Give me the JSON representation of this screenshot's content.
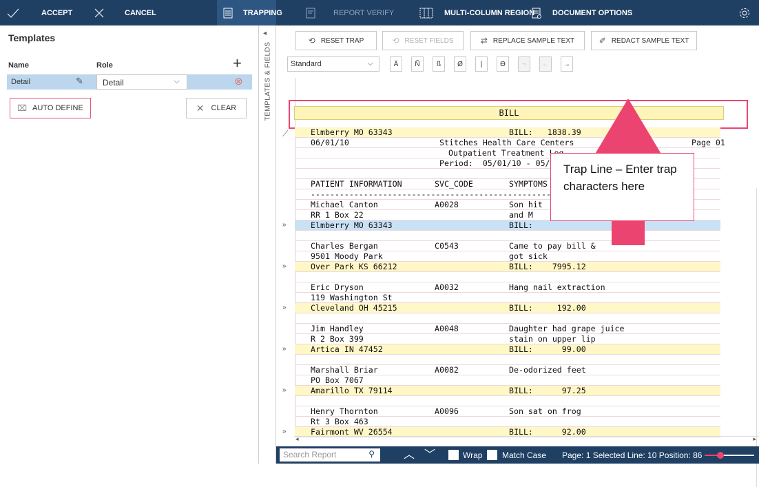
{
  "toolbar": {
    "accept_label": "ACCEPT",
    "cancel_label": "CANCEL",
    "trapping_label": "TRAPPING",
    "report_verify_label": "REPORT VERIFY",
    "multi_column_label": "MULTI-COLUMN REGION",
    "document_options_label": "DOCUMENT OPTIONS"
  },
  "templates": {
    "title": "Templates",
    "col_name": "Name",
    "col_role": "Role",
    "row": {
      "name": "Detail",
      "role": "Detail"
    },
    "auto_define_label": "AUTO DEFINE",
    "clear_label": "CLEAR",
    "side_tab_label": "TEMPLATES & FIELDS"
  },
  "actions": {
    "reset_trap": "RESET TRAP",
    "reset_fields": "RESET FIELDS",
    "replace_sample": "REPLACE SAMPLE TEXT",
    "redact_sample": "REDACT SAMPLE TEXT",
    "trap_type": "Standard",
    "char_buttons": [
      "Ä",
      "Ñ",
      "ß",
      "Ø",
      "|",
      "ϴ",
      "¬",
      "←",
      "→"
    ]
  },
  "trap_line": {
    "value": "BILL"
  },
  "report": {
    "lines": [
      {
        "c1": "Elmberry MO 63343",
        "c2": "",
        "c3": "BILL:   1838.39",
        "type": "hl"
      },
      {
        "c1": "06/01/10",
        "c2": "Stitches Health Care Centers",
        "c3": "Page 01",
        "type": "head1"
      },
      {
        "c1": "",
        "c2": "Outpatient Treatment Log",
        "c3": "",
        "type": "head2"
      },
      {
        "c1": "",
        "c2": "Period:  05/01/10 - 05/31/10",
        "c3": "",
        "type": "head3"
      },
      {
        "c1": "",
        "c2": "",
        "c3": "",
        "type": "blank"
      },
      {
        "c1": "PATIENT INFORMATION",
        "c2": "SVC_CODE",
        "c3": "SYMPTOMS",
        "type": "cols"
      },
      {
        "c1": "----------------------------------------------------------------",
        "c2": "",
        "c3": "",
        "type": "dash"
      },
      {
        "c1": "Michael Canton",
        "c2": "A0028",
        "c3": "Son hit",
        "type": "p"
      },
      {
        "c1": "RR 1 Box 22",
        "c2": "",
        "c3": "and M",
        "type": "p"
      },
      {
        "c1": "Elmberry MO 63343",
        "c2": "",
        "c3": "BILL:",
        "type": "sel"
      },
      {
        "c1": "",
        "c2": "",
        "c3": "",
        "type": "blank"
      },
      {
        "c1": "Charles Bergan",
        "c2": "C0543",
        "c3": "Came to pay bill &",
        "type": "p"
      },
      {
        "c1": "9501 Moody Park",
        "c2": "",
        "c3": "got sick",
        "type": "p"
      },
      {
        "c1": "Over Park KS 66212",
        "c2": "",
        "c3": "BILL:    7995.12",
        "type": "hl"
      },
      {
        "c1": "",
        "c2": "",
        "c3": "",
        "type": "blank"
      },
      {
        "c1": "Eric Dryson",
        "c2": "A0032",
        "c3": "Hang nail extraction",
        "type": "p"
      },
      {
        "c1": "119 Washington St",
        "c2": "",
        "c3": "",
        "type": "p"
      },
      {
        "c1": "Cleveland OH 45215",
        "c2": "",
        "c3": "BILL:     192.00",
        "type": "hl"
      },
      {
        "c1": "",
        "c2": "",
        "c3": "",
        "type": "blank"
      },
      {
        "c1": "Jim Handley",
        "c2": "A0048",
        "c3": "Daughter had grape juice",
        "type": "p"
      },
      {
        "c1": "R 2 Box 399",
        "c2": "",
        "c3": "stain on upper lip",
        "type": "p"
      },
      {
        "c1": "Artica IN 47452",
        "c2": "",
        "c3": "BILL:      99.00",
        "type": "hl"
      },
      {
        "c1": "",
        "c2": "",
        "c3": "",
        "type": "blank"
      },
      {
        "c1": "Marshall Briar",
        "c2": "A0082",
        "c3": "De-odorized feet",
        "type": "p"
      },
      {
        "c1": "PO Box 7067",
        "c2": "",
        "c3": "",
        "type": "p"
      },
      {
        "c1": "Amarillo TX 79114",
        "c2": "",
        "c3": "BILL:      97.25",
        "type": "hl"
      },
      {
        "c1": "",
        "c2": "",
        "c3": "",
        "type": "blank"
      },
      {
        "c1": "Henry Thornton",
        "c2": "A0096",
        "c3": "Son sat on frog",
        "type": "p"
      },
      {
        "c1": "Rt 3 Box 463",
        "c2": "",
        "c3": "",
        "type": "p"
      },
      {
        "c1": "Fairmont WV 26554",
        "c2": "",
        "c3": "BILL:      92.00",
        "type": "hl"
      }
    ],
    "row_marker": "»"
  },
  "status": {
    "search_placeholder": "Search Report",
    "wrap_label": "Wrap",
    "match_case_label": "Match Case",
    "position_text": "Page: 1  Selected Line: 10  Position: 86"
  },
  "callout": {
    "text": "Trap Line – Enter trap characters here"
  },
  "colors": {
    "nav": "#1f3f63",
    "accent": "#ec4470",
    "highlight": "#fff7c6",
    "selected": "#c9e1f5"
  }
}
